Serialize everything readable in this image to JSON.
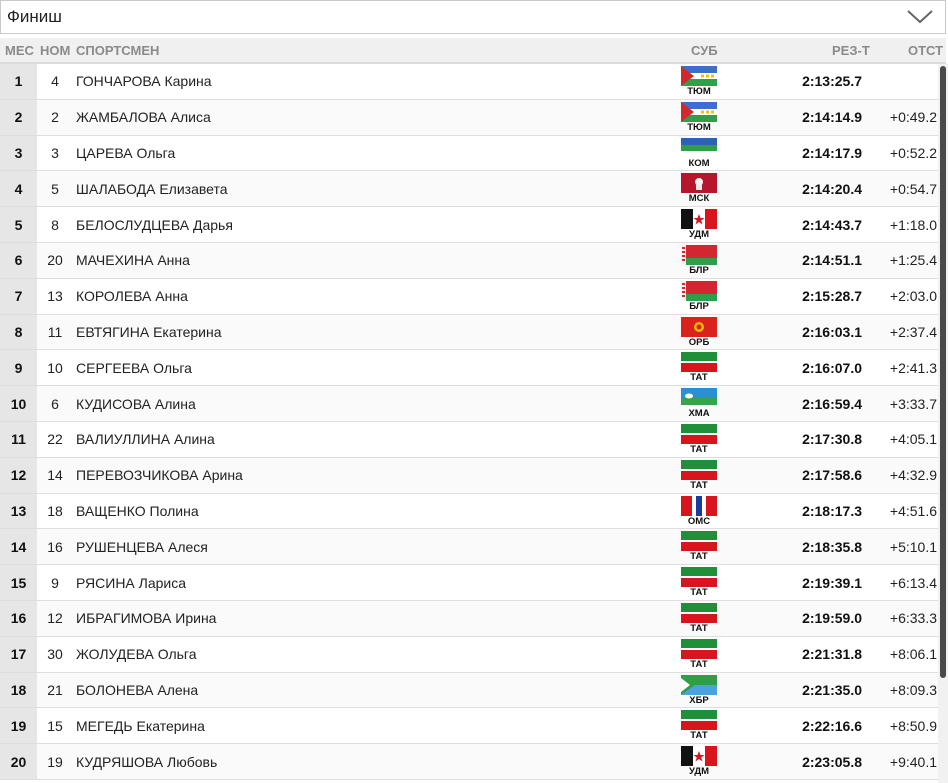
{
  "filter": {
    "selected": "Финиш"
  },
  "columns": {
    "place": "МЕС",
    "bib": "НОМ",
    "athlete": "СПОРТСМЕН",
    "region": "СУБ",
    "result": "РЕЗ-Т",
    "gap": "ОТСТ"
  },
  "rows": [
    {
      "place": "1",
      "bib": "4",
      "name": "ГОНЧАРОВА Карина",
      "code": "ТЮМ",
      "flag": "tyumen",
      "result": "2:13:25.7",
      "gap": ""
    },
    {
      "place": "2",
      "bib": "2",
      "name": "ЖАМБАЛОВА Алиса",
      "code": "ТЮМ",
      "flag": "tyumen",
      "result": "2:14:14.9",
      "gap": "+0:49.2"
    },
    {
      "place": "3",
      "bib": "3",
      "name": "ЦАРЕВА Ольга",
      "code": "КОМ",
      "flag": "komi",
      "result": "2:14:17.9",
      "gap": "+0:52.2"
    },
    {
      "place": "4",
      "bib": "5",
      "name": "ШАЛАБОДА Елизавета",
      "code": "МСК",
      "flag": "moscow",
      "result": "2:14:20.4",
      "gap": "+0:54.7"
    },
    {
      "place": "5",
      "bib": "8",
      "name": "БЕЛОСЛУДЦЕВА Дарья",
      "code": "УДМ",
      "flag": "udmurtia",
      "result": "2:14:43.7",
      "gap": "+1:18.0"
    },
    {
      "place": "6",
      "bib": "20",
      "name": "МАЧЕХИНА Анна",
      "code": "БЛР",
      "flag": "belarus",
      "result": "2:14:51.1",
      "gap": "+1:25.4"
    },
    {
      "place": "7",
      "bib": "13",
      "name": "КОРОЛЕВА Анна",
      "code": "БЛР",
      "flag": "belarus",
      "result": "2:15:28.7",
      "gap": "+2:03.0"
    },
    {
      "place": "8",
      "bib": "11",
      "name": "ЕВТЯГИНА Екатерина",
      "code": "ОРБ",
      "flag": "orenburg",
      "result": "2:16:03.1",
      "gap": "+2:37.4"
    },
    {
      "place": "9",
      "bib": "10",
      "name": "СЕРГЕЕВА Ольга",
      "code": "ТАТ",
      "flag": "tatarstan",
      "result": "2:16:07.0",
      "gap": "+2:41.3"
    },
    {
      "place": "10",
      "bib": "6",
      "name": "КУДИСОВА Алина",
      "code": "ХМА",
      "flag": "khmao",
      "result": "2:16:59.4",
      "gap": "+3:33.7"
    },
    {
      "place": "11",
      "bib": "22",
      "name": "ВАЛИУЛЛИНА Алина",
      "code": "ТАТ",
      "flag": "tatarstan",
      "result": "2:17:30.8",
      "gap": "+4:05.1"
    },
    {
      "place": "12",
      "bib": "14",
      "name": "ПЕРЕВОЗЧИКОВА Арина",
      "code": "ТАТ",
      "flag": "tatarstan",
      "result": "2:17:58.6",
      "gap": "+4:32.9"
    },
    {
      "place": "13",
      "bib": "18",
      "name": "ВАЩЕНКО Полина",
      "code": "ОМС",
      "flag": "omsk",
      "result": "2:18:17.3",
      "gap": "+4:51.6"
    },
    {
      "place": "14",
      "bib": "16",
      "name": "РУШЕНЦЕВА Алеся",
      "code": "ТАТ",
      "flag": "tatarstan",
      "result": "2:18:35.8",
      "gap": "+5:10.1"
    },
    {
      "place": "15",
      "bib": "9",
      "name": "РЯСИНА Лариса",
      "code": "ТАТ",
      "flag": "tatarstan",
      "result": "2:19:39.1",
      "gap": "+6:13.4"
    },
    {
      "place": "16",
      "bib": "12",
      "name": "ИБРАГИМОВА Ирина",
      "code": "ТАТ",
      "flag": "tatarstan",
      "result": "2:19:59.0",
      "gap": "+6:33.3"
    },
    {
      "place": "17",
      "bib": "30",
      "name": "ЖОЛУДЕВА Ольга",
      "code": "ТАТ",
      "flag": "tatarstan",
      "result": "2:21:31.8",
      "gap": "+8:06.1"
    },
    {
      "place": "18",
      "bib": "21",
      "name": "БОЛОНЕВА Алена",
      "code": "ХБР",
      "flag": "khabarovsk",
      "result": "2:21:35.0",
      "gap": "+8:09.3"
    },
    {
      "place": "19",
      "bib": "15",
      "name": "МЕГЕДЬ Екатерина",
      "code": "ТАТ",
      "flag": "tatarstan",
      "result": "2:22:16.6",
      "gap": "+8:50.9"
    },
    {
      "place": "20",
      "bib": "19",
      "name": "КУДРЯШОВА Любовь",
      "code": "УДМ",
      "flag": "udmurtia",
      "result": "2:23:05.8",
      "gap": "+9:40.1"
    }
  ]
}
